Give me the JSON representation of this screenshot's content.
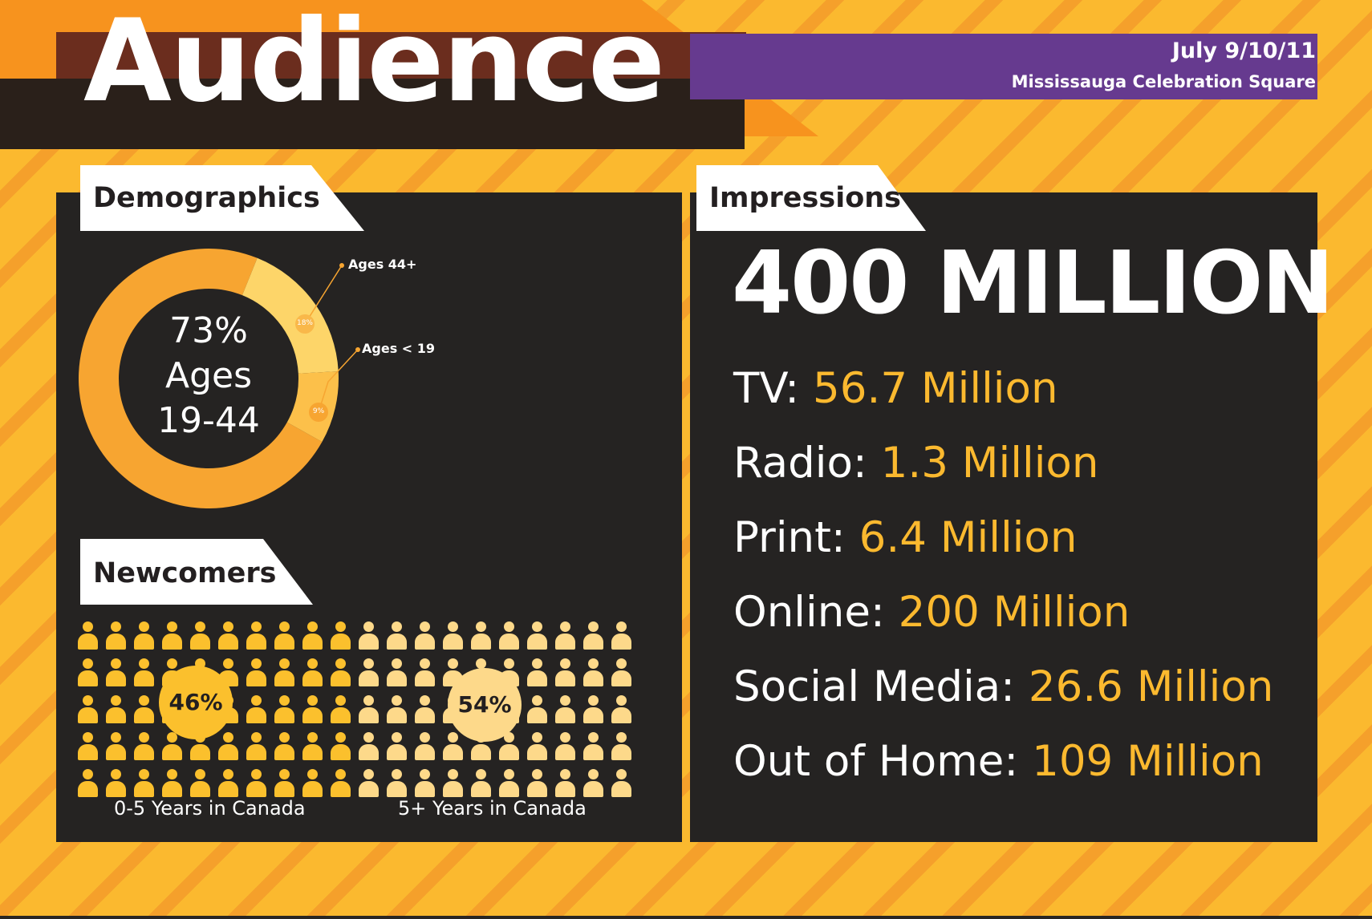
{
  "header": {
    "title": "Audience",
    "date": "July 9/10/11",
    "venue": "Mississauga Celebration Square"
  },
  "colors": {
    "background": "#fbb92f",
    "stripes": "#f08c28",
    "panel": "#252322",
    "accent": "#fbb92f",
    "header_purple": "#663a8f",
    "donut_major": "#f7a531",
    "donut_44plus": "#fdd569",
    "donut_under19": "#fcc04a",
    "people_newcomers": "#fbc02d",
    "people_established": "#fdd98a"
  },
  "demographics": {
    "heading": "Demographics",
    "center": {
      "pct": "73%",
      "label": "Ages",
      "range": "19-44"
    },
    "slices": [
      {
        "label": "Ages 19-44",
        "share": 73
      },
      {
        "label": "Ages 44+",
        "share": 18,
        "pct_text": "18%"
      },
      {
        "label": "Ages < 19",
        "share": 9,
        "pct_text": "9%"
      }
    ],
    "callout_44plus": "Ages 44+",
    "callout_under19": "Ages < 19"
  },
  "newcomers": {
    "heading": "Newcomers",
    "groups": [
      {
        "pct": "46%",
        "caption": "0-5 Years in Canada"
      },
      {
        "pct": "54%",
        "caption": "5+ Years in Canada"
      }
    ]
  },
  "impressions": {
    "heading": "Impressions",
    "total": "400 MILLION",
    "rows": [
      {
        "label": "TV:",
        "value": "56.7 Million"
      },
      {
        "label": "Radio:",
        "value": "1.3 Million"
      },
      {
        "label": "Print:",
        "value": "6.4 Million"
      },
      {
        "label": "Online:",
        "value": "200 Million"
      },
      {
        "label": "Social Media:",
        "value": "26.6 Million"
      },
      {
        "label": "Out of Home:",
        "value": "109 Million"
      }
    ]
  }
}
